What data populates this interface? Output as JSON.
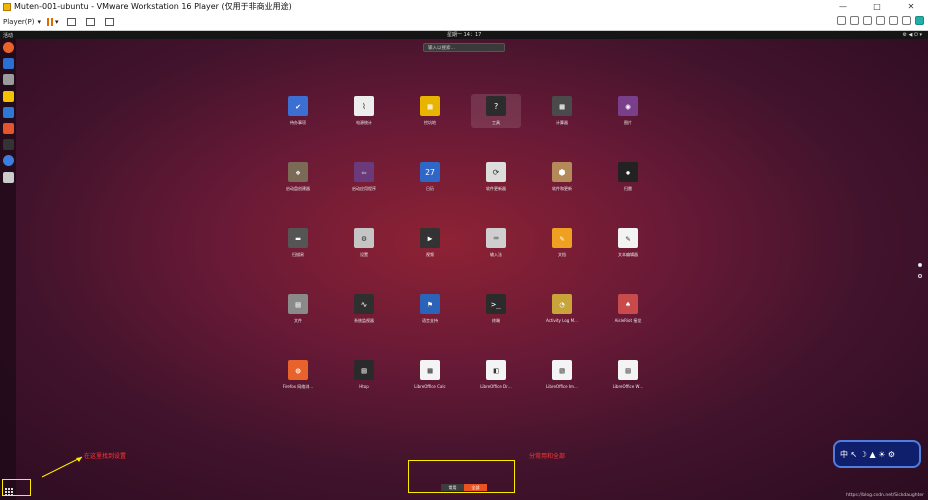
{
  "window": {
    "title": "Muten-001-ubuntu - VMware Workstation 16 Player (仅用于非商业用途)"
  },
  "window_controls": [
    "—",
    "□",
    "✕"
  ],
  "toolbar": {
    "player_menu": "Player(P)"
  },
  "topbar": {
    "activities": "活动",
    "clock": "星期一 14：17",
    "tray": "⚙ ◀ ⏻ ▾"
  },
  "search": {
    "placeholder": "输入以搜索…"
  },
  "apps": [
    {
      "label": "待办事项",
      "color": "#3b6fd1",
      "glyph": "✔"
    },
    {
      "label": "电源统计",
      "color": "#ededed",
      "glyph": "⌇"
    },
    {
      "label": "挖坑地",
      "color": "#e8b400",
      "glyph": "▦"
    },
    {
      "label": "工具",
      "color": "#2c2c2c",
      "glyph": "?"
    },
    {
      "label": "计算器",
      "color": "#4a4a4a",
      "glyph": "▦"
    },
    {
      "label": "图片",
      "color": "#7a3f8a",
      "glyph": "◉"
    },
    {
      "label": "启动盘创建器",
      "color": "#7b6a55",
      "glyph": "❖"
    },
    {
      "label": "启动应用程序",
      "color": "#6a3a7a",
      "glyph": "⇦"
    },
    {
      "label": "日历",
      "color": "#2e67c8",
      "glyph": "27"
    },
    {
      "label": "软件更新器",
      "color": "#dddddd",
      "glyph": "⟳"
    },
    {
      "label": "软件和更新",
      "color": "#b58a5a",
      "glyph": "⬢"
    },
    {
      "label": "扫雷",
      "color": "#222222",
      "glyph": "✹"
    },
    {
      "label": "扫描易",
      "color": "#555555",
      "glyph": "▬"
    },
    {
      "label": "设置",
      "color": "#c5c5c5",
      "glyph": "⚙"
    },
    {
      "label": "视频",
      "color": "#333333",
      "glyph": "▶"
    },
    {
      "label": "输入法",
      "color": "#cfcfcf",
      "glyph": "⌨"
    },
    {
      "label": "文档",
      "color": "#f0a020",
      "glyph": "✎"
    },
    {
      "label": "文本编辑器",
      "color": "#f3f3f3",
      "glyph": "✎"
    },
    {
      "label": "文件",
      "color": "#8a8a8a",
      "glyph": "▤"
    },
    {
      "label": "系统监视器",
      "color": "#2f2f2f",
      "glyph": "∿"
    },
    {
      "label": "语言支持",
      "color": "#2a63b8",
      "glyph": "⚑"
    },
    {
      "label": "终端",
      "color": "#2b2b2b",
      "glyph": ">_"
    },
    {
      "label": "Activity Log M…",
      "color": "#c9a43a",
      "glyph": "◔"
    },
    {
      "label": "AisleRiot 接龙",
      "color": "#c84a4a",
      "glyph": "♠"
    },
    {
      "label": "Firefox 网络浏…",
      "color": "#e8622c",
      "glyph": "◍"
    },
    {
      "label": "Htop",
      "color": "#2a2a2a",
      "glyph": "▤"
    },
    {
      "label": "LibreOffice Calc",
      "color": "#f4f4f4",
      "glyph": "▦"
    },
    {
      "label": "LibreOffice Dr…",
      "color": "#f4f4f4",
      "glyph": "◧"
    },
    {
      "label": "LibreOffice Im…",
      "color": "#f4f4f4",
      "glyph": "▧"
    },
    {
      "label": "LibreOffice W…",
      "color": "#f4f4f4",
      "glyph": "▤"
    }
  ],
  "dock": [
    {
      "name": "firefox",
      "color": "#e8622c"
    },
    {
      "name": "thunderbird",
      "color": "#2a6fd1"
    },
    {
      "name": "files",
      "color": "#9b9b9b"
    },
    {
      "name": "rhythmbox",
      "color": "#f2c200"
    },
    {
      "name": "libreoffice-writer",
      "color": "#2c7ad6"
    },
    {
      "name": "software",
      "color": "#e5552d"
    },
    {
      "name": "terminal",
      "color": "#333333"
    },
    {
      "name": "help",
      "color": "#3a7ee0"
    },
    {
      "name": "settings",
      "color": "#cccccc"
    }
  ],
  "annotations": {
    "apps_button": "在这里找到设置",
    "tabs": "分常用和全部"
  },
  "segmented": {
    "frequent": "常用",
    "all": "全部"
  },
  "widget": {
    "text": "中 ↖ ☽ ▲ ☀ ⚙",
    "color": "#4f7ee0"
  },
  "credit": "https://blog.csdn.net/Sickdaughter"
}
